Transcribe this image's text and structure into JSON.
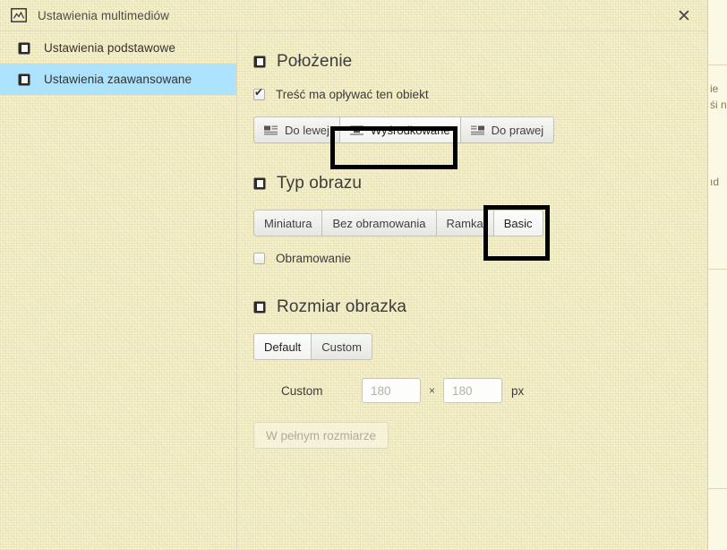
{
  "window": {
    "title": "Ustawienia multimediów",
    "title_icon": "image-icon",
    "close_label": "✕"
  },
  "sidebar": {
    "items": [
      {
        "label": "Ustawienia podstawowe",
        "icon": "panel-icon",
        "selected": false
      },
      {
        "label": "Ustawienia zaawansowane",
        "icon": "panel-icon",
        "selected": true
      }
    ]
  },
  "content": {
    "position_section": {
      "icon": "panel-icon",
      "title": "Położenie",
      "wrap_checkbox": {
        "label": "Treść ma opływać ten obiekt",
        "checked": true
      },
      "align_buttons": [
        {
          "label": "Do lewej",
          "icon": "align-left-icon",
          "active": false
        },
        {
          "label": "Wyśrodkowane",
          "icon": "align-center-icon",
          "active": true
        },
        {
          "label": "Do prawej",
          "icon": "align-right-icon",
          "active": false
        }
      ]
    },
    "image_type_section": {
      "icon": "panel-icon",
      "title": "Typ obrazu",
      "type_buttons": [
        {
          "label": "Miniatura",
          "active": false
        },
        {
          "label": "Bez obramowania",
          "active": false
        },
        {
          "label": "Ramka",
          "active": false
        },
        {
          "label": "Basic",
          "active": true
        }
      ],
      "border_checkbox": {
        "label": "Obramowanie",
        "checked": false
      }
    },
    "image_size_section": {
      "icon": "panel-icon",
      "title": "Rozmiar obrazka",
      "size_buttons": [
        {
          "label": "Default",
          "active": true
        },
        {
          "label": "Custom",
          "active": false
        }
      ],
      "custom_row": {
        "label": "Custom",
        "width_placeholder": "180",
        "width_value": "",
        "separator": "×",
        "height_placeholder": "180",
        "height_value": "",
        "unit": "px"
      },
      "full_size_button": {
        "label": "W pełnym rozmiarze",
        "disabled": true
      }
    }
  },
  "underlay": {
    "fragments": [
      "ie",
      "śi n",
      "ıd"
    ]
  },
  "colors": {
    "page_background": "#f5f1cf",
    "selection_blue": "#ace2fb",
    "highlight_outline": "#000000",
    "divider": "#ddd7b5",
    "text": "#3c3c3c"
  }
}
